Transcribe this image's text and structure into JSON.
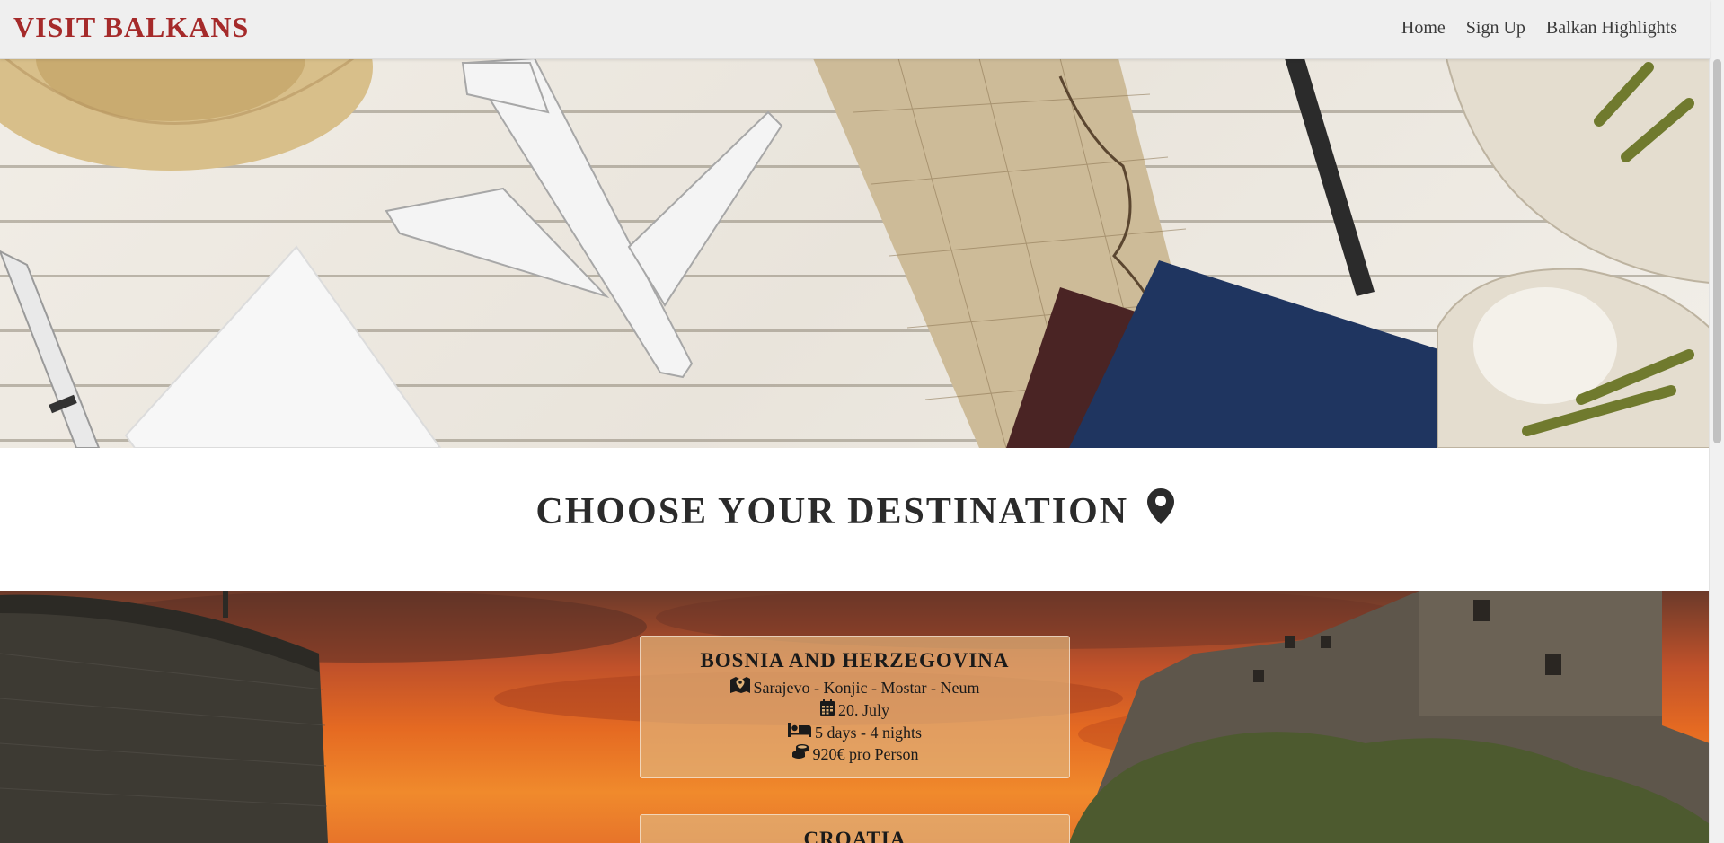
{
  "navbar": {
    "brand": "VISIT BALKANS",
    "links": [
      {
        "label": "Home"
      },
      {
        "label": "Sign Up"
      },
      {
        "label": "Balkan Highlights"
      }
    ]
  },
  "colors": {
    "brand": "#a52a2a",
    "card_background": "#e0b278",
    "heading": "#2b2b2b"
  },
  "main": {
    "heading": "CHOOSE YOUR DESTINATION",
    "heading_icon": "map-marker-icon"
  },
  "destinations": [
    {
      "title": "BOSNIA AND HERZEGOVINA",
      "route": "Sarajevo - Konjic - Mostar - Neum",
      "route_icon": "map-icon",
      "date": "20. July",
      "date_icon": "calendar-icon",
      "duration": "5 days - 4 nights",
      "duration_icon": "bed-icon",
      "price": "920€ pro Person",
      "price_icon": "coins-icon"
    },
    {
      "title": "CROATIA"
    }
  ]
}
